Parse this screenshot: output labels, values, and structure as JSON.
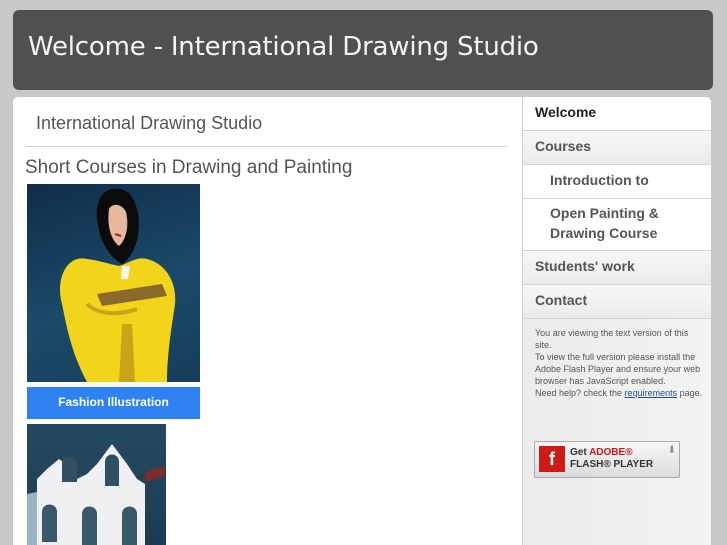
{
  "header": {
    "title": "Welcome - International Drawing Studio"
  },
  "main": {
    "site_title": "International Drawing Studio",
    "subtitle": "Short Courses in Drawing and Painting",
    "images": [
      {
        "caption": "Fashion Illustration"
      },
      {
        "caption": ""
      }
    ]
  },
  "sidebar": {
    "nav": [
      {
        "label": "Welcome",
        "active": true
      },
      {
        "label": "Courses"
      },
      {
        "label": "Introduction to",
        "sub": true
      },
      {
        "label": "Open Painting & Drawing Course",
        "sub": true
      },
      {
        "label": "Students' work"
      },
      {
        "label": "Contact"
      }
    ],
    "note": {
      "line1": "You are viewing the text version of this site.",
      "line2": "To view the full version please install the Adobe Flash Player and ensure your web browser has JavaScript enabled.",
      "line3_pre": "Need help? check the ",
      "link": "requirements",
      "line3_post": " page."
    },
    "flash_badge": {
      "line1_prefix": "Get ",
      "line1_brand": "ADOBE",
      "line1_reg": "®",
      "line2": "FLASH® PLAYER",
      "logo_glyph": "f"
    }
  },
  "colors": {
    "header_bg": "#505050",
    "caption_bg": "#2f82f4",
    "flash_red": "#cc1a14"
  }
}
